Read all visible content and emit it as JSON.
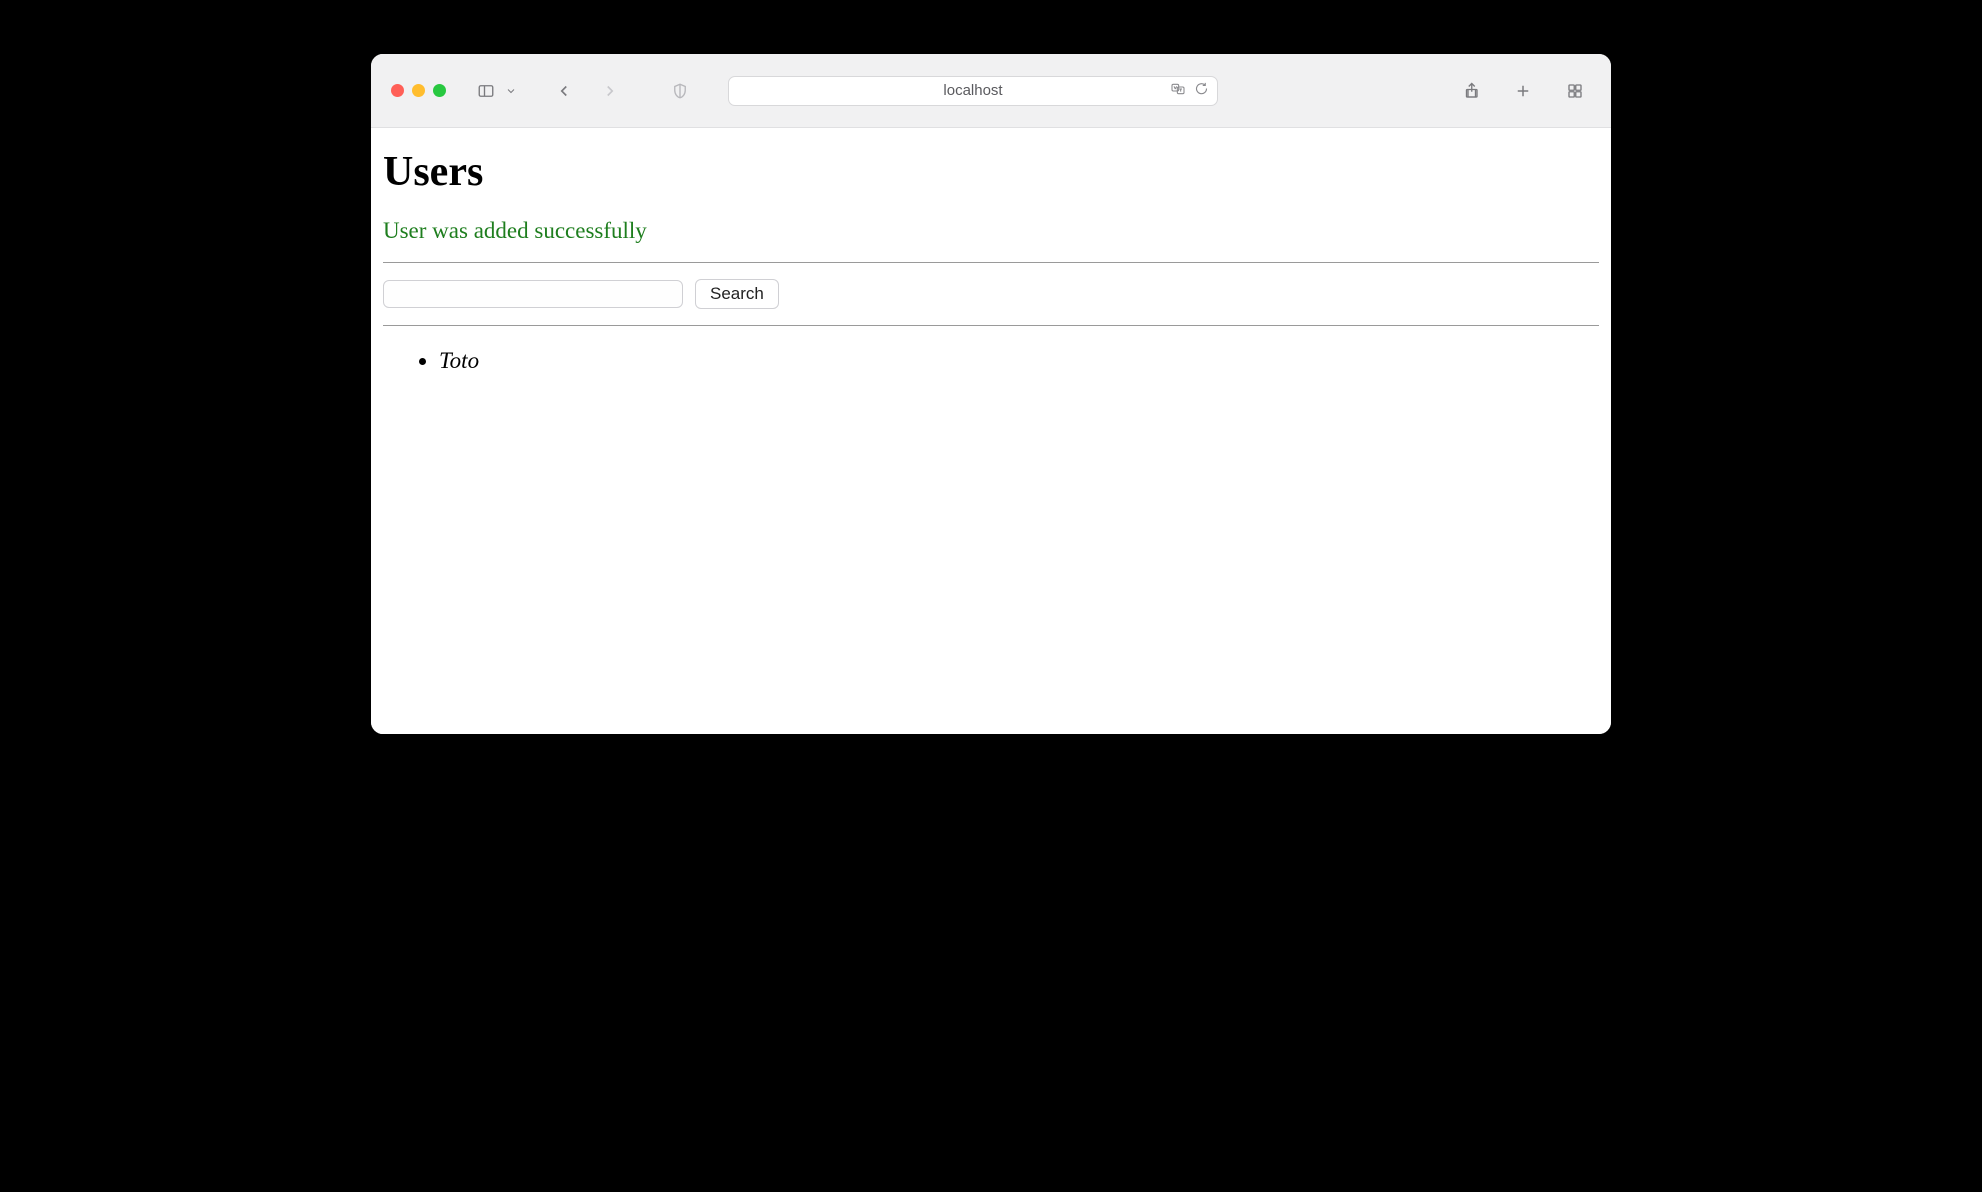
{
  "browser": {
    "url": "localhost"
  },
  "page": {
    "title": "Users",
    "success_message": "User was added successfully",
    "search": {
      "value": "",
      "button_label": "Search"
    },
    "users": [
      {
        "name": "Toto"
      }
    ]
  }
}
